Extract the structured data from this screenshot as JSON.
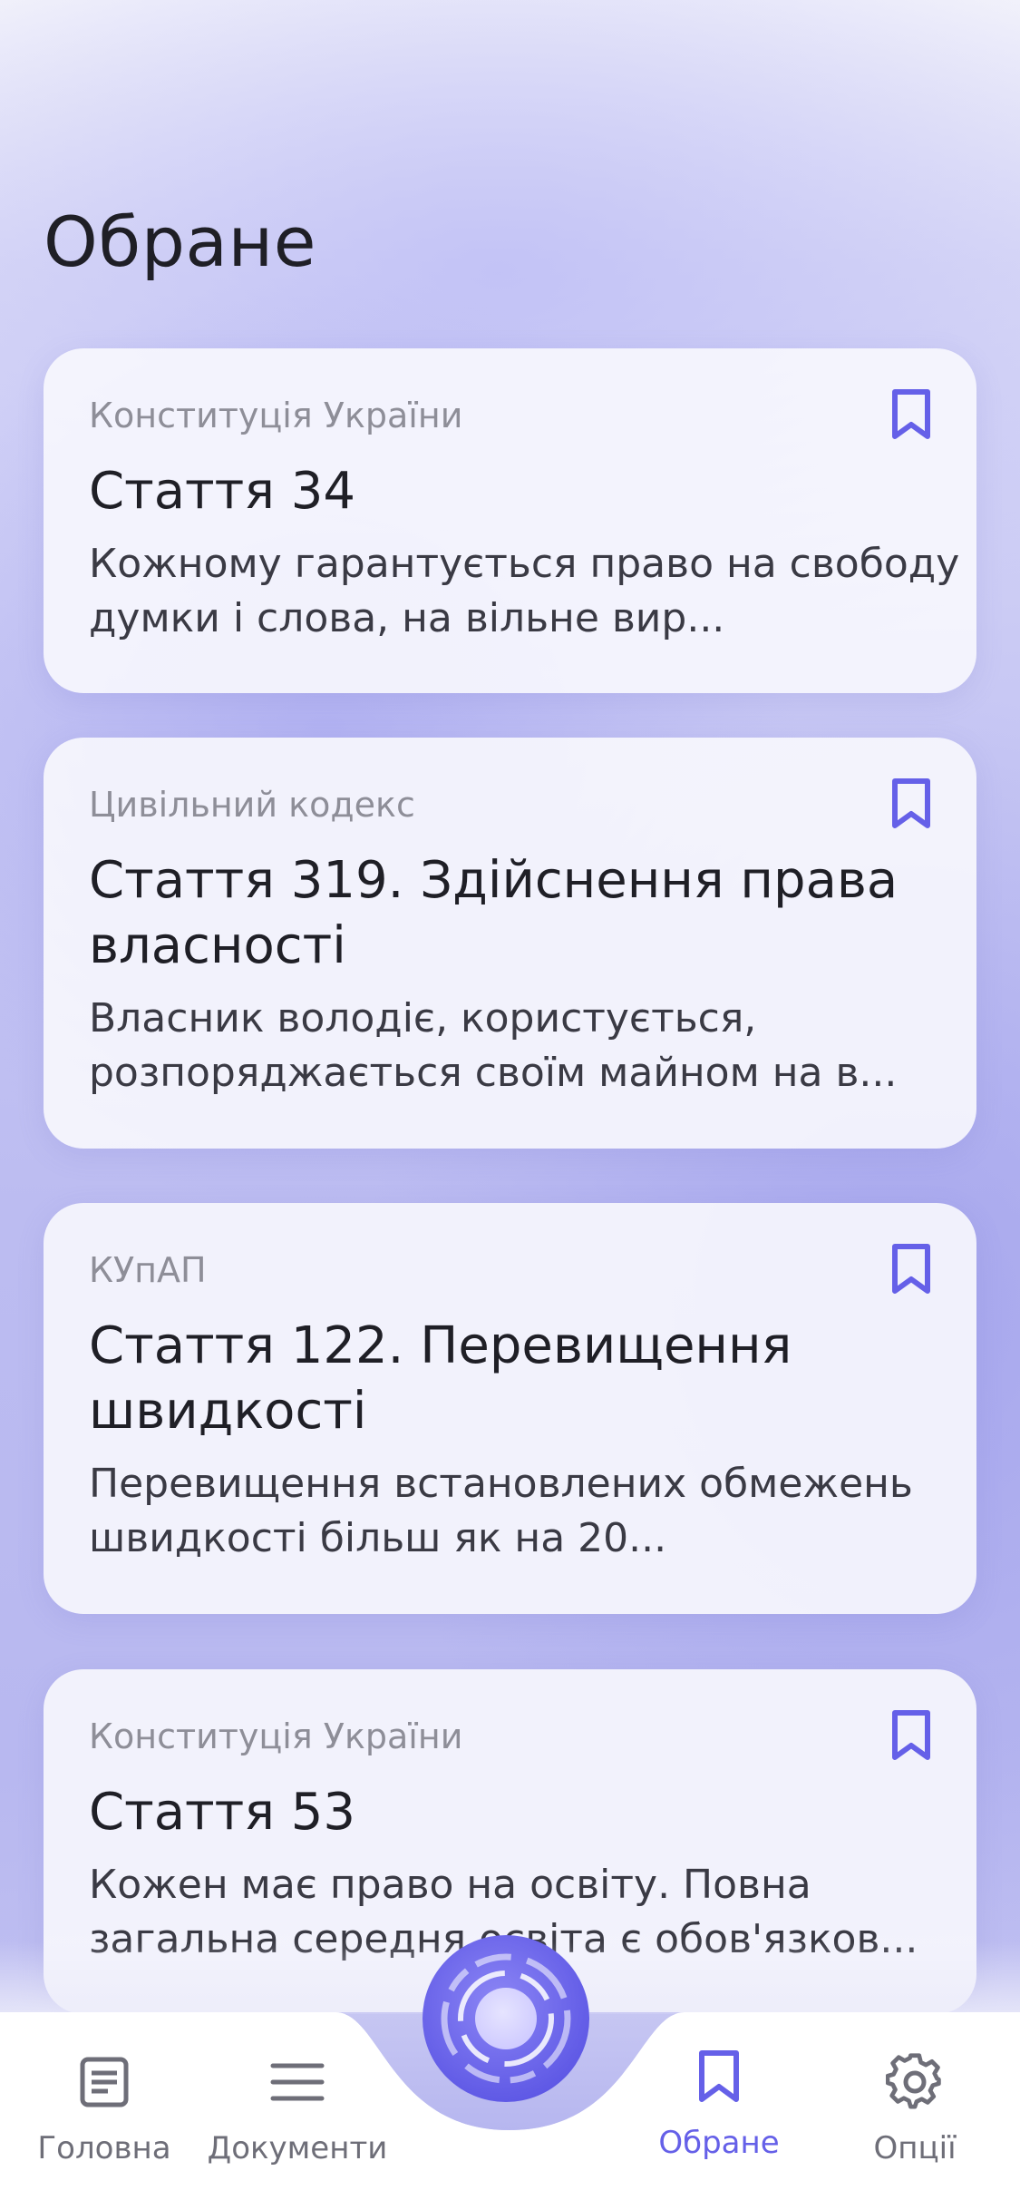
{
  "page_title": "Обране",
  "cards": [
    {
      "source": "Конституція України",
      "title": "Стаття 34",
      "excerpt": "Кожному гарантується право на свободу думки і слова, на вільне вир..."
    },
    {
      "source": "Цивільний кодекс",
      "title": "Стаття 319. Здійснення права власності",
      "excerpt": "Власник володіє, користується, розпоряджається своїм майном на в..."
    },
    {
      "source": "КУпАП",
      "title": "Стаття 122. Перевищення швидкості",
      "excerpt": "Перевищення встановлених обмежень швидкості більш як на 20..."
    },
    {
      "source": "Конституція України",
      "title": "Стаття 53",
      "excerpt": "Кожен має право на освіту. Повна загальна середня освіта є обов'язков..."
    }
  ],
  "tabbar": {
    "tabs": [
      {
        "label": "Головна",
        "icon": "document-icon"
      },
      {
        "label": "Документи",
        "icon": "menu-icon"
      },
      {
        "label": "Обране",
        "icon": "bookmark-icon",
        "active": true
      },
      {
        "label": "Опції",
        "icon": "gear-icon"
      }
    ],
    "center_button_icon": "assistant-orb-icon"
  },
  "colors": {
    "accent": "#6560e8",
    "text_primary": "#1f1f26",
    "text_secondary": "#8e8e98"
  }
}
